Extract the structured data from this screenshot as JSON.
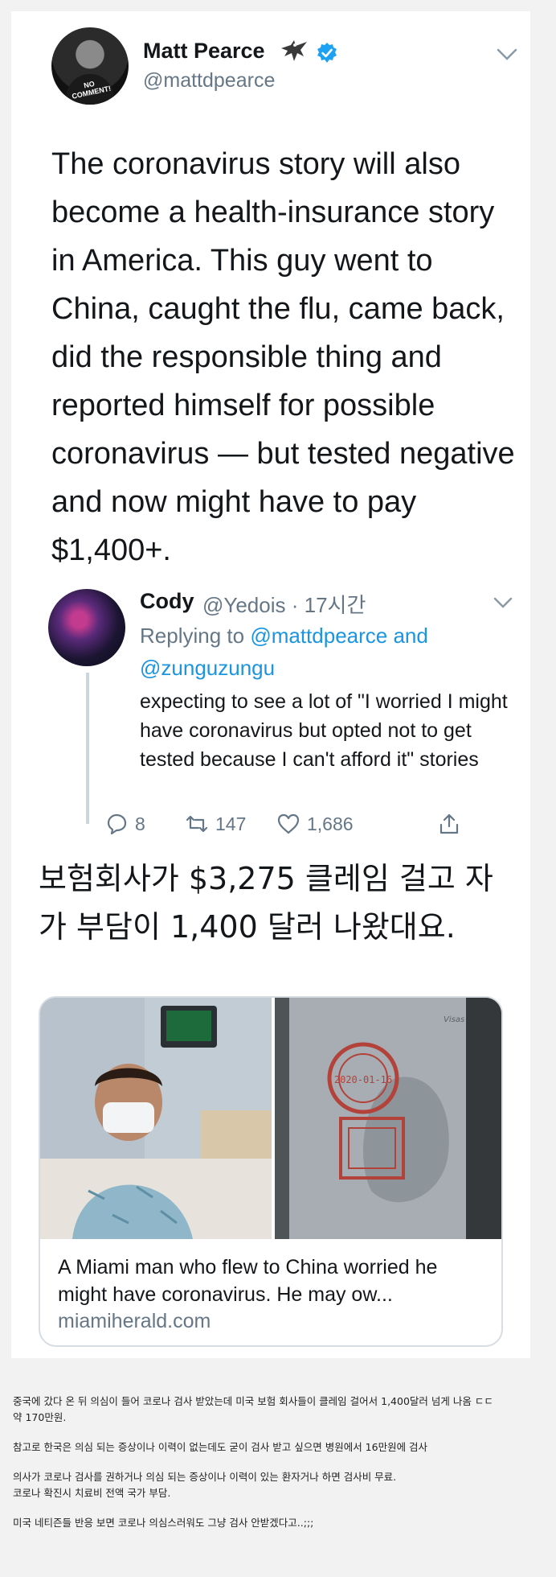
{
  "tweet": {
    "author_name": "Matt Pearce",
    "author_handle": "@mattdpearce",
    "avatar_shirt_text": "NO COMMENT!",
    "text": "The coronavirus story will also become a health-insurance story in America. This guy went to China, caught the flu, came back, did the responsible thing and reported himself for possible coronavirus — but tested negative and now might have to pay $1,400+."
  },
  "reply": {
    "author_name": "Cody",
    "author_handle": "@Yedois · 17시간",
    "replying_prefix": "Replying to ",
    "replying_user1": "@mattdpearce",
    "replying_and": " and",
    "replying_user2": "@zunguzungu",
    "text": "expecting to see a lot of \"I worried I might have coronavirus but opted not to get tested because I can't afford it\" stories",
    "replies": "8",
    "retweets": "147",
    "likes": "1,686"
  },
  "caption": "보험회사가 $3,275 클레임 걸고 자가 부담이 1,400 달러 나왔대요.",
  "link_card": {
    "title": "A Miami man who flew to China worried he might have coronavirus. He may ow...",
    "domain": "miamiherald.com",
    "stamp_date": "2020-01-16",
    "passport_label": "Visas"
  },
  "post_body": {
    "line1": "중국에 갔다 온 뒤 의심이 들어 코로나 검사 받았는데 미국 보험 회사들이 클레임 걸어서 1,400달러 넘게 나옴 ㄷㄷ",
    "line2": "약 170만원.",
    "line3": "참고로 한국은 의심 되는 증상이나 이력이 없는데도 굳이 검사 받고 싶으면 병원에서 16만원에 검사",
    "line4": "의사가 코로나 검사를 권하거나 의심 되는 증상이나 이력이 있는 환자거나 하면 검사비 무료.",
    "line5": "코로나 확진시 치료비 전액 국가 부담.",
    "line6": "미국 네티즌들 반응 보면 코로나 의심스러워도 그냥 검사 안받겠다고..;;;"
  },
  "colors": {
    "link_blue": "#1b95e0",
    "verified_blue": "#1da1f2",
    "secondary_gray": "#657786"
  }
}
